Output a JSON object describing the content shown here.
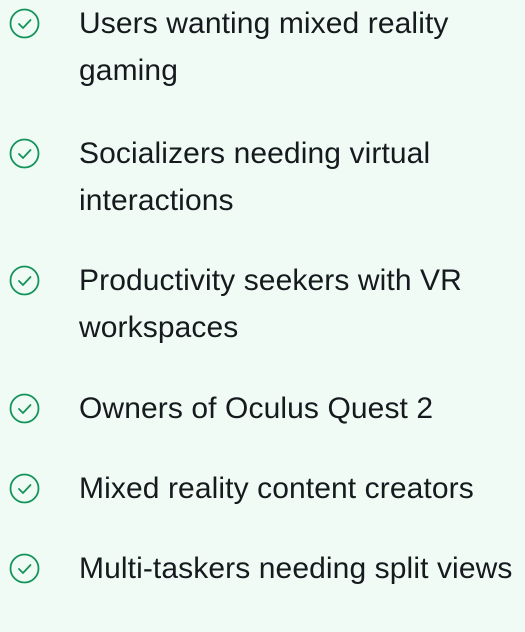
{
  "accent_color": "#14935a",
  "background_color": "#effbf4",
  "items": [
    {
      "icon": "check-circle-icon",
      "label": "Users wanting mixed reality gaming"
    },
    {
      "icon": "check-circle-icon",
      "label": "Socializers needing virtual interactions"
    },
    {
      "icon": "check-circle-icon",
      "label": "Productivity seekers with VR workspaces"
    },
    {
      "icon": "check-circle-icon",
      "label": "Owners of Oculus Quest 2"
    },
    {
      "icon": "check-circle-icon",
      "label": "Mixed reality content creators"
    },
    {
      "icon": "check-circle-icon",
      "label": "Multi-taskers needing split views"
    }
  ]
}
